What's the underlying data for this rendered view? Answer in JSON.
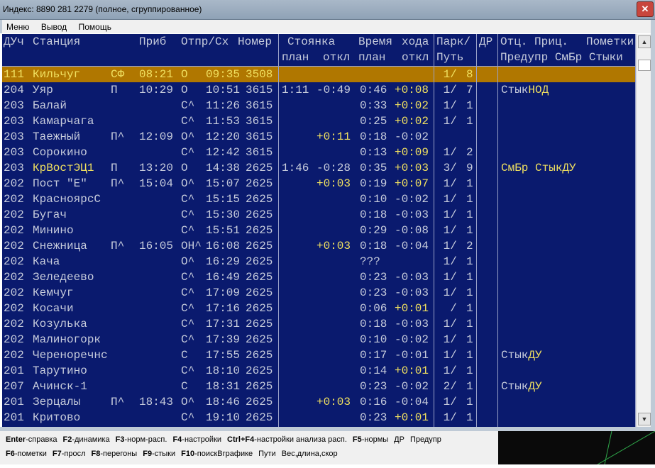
{
  "window": {
    "title": "Индекс: 8890 281 2279 (полное, сгруппированное)",
    "close_icon": "close-icon"
  },
  "menu": [
    "Меню",
    "Вывод",
    "Помощь"
  ],
  "headers": {
    "duch": "ДУч",
    "station": "Станция",
    "prib": "Приб",
    "otpr": "Отпр/Сх",
    "nomer": "Номер",
    "stoyanka": "Стоянка",
    "stoyanka_plan": "план",
    "stoyanka_otkl": "откл",
    "vremya": "Время",
    "hoda": "хода",
    "vremya_plan": "план",
    "vremya_otkl": "откл",
    "park": "Парк/",
    "put": "Путь",
    "dr": "ДР",
    "otc_pric": "Отц. Приц.",
    "pometki": "Пометки",
    "predupr": "Предупр СмБр Стыки"
  },
  "rows": [
    {
      "duch": "111",
      "station": "Кильчуг",
      "mark": "СФ",
      "prib": "08:21",
      "otpr_flag": "О",
      "otpr": "09:35",
      "nomer": "3508",
      "st_plan": "",
      "st_otkl": "",
      "vr_plan": "",
      "vr_otkl": "",
      "park": "1/",
      "put": "8",
      "pom_a": "",
      "pom_b": "",
      "selected": true
    },
    {
      "duch": "204",
      "station": "Уяр",
      "mark": "П",
      "prib": "10:29",
      "otpr_flag": "О",
      "otpr": "10:51",
      "nomer": "3615",
      "st_plan": "1:11",
      "st_otkl": "-0:49",
      "vr_plan": "0:46",
      "vr_otkl": "+0:08",
      "park": "1/",
      "put": "7",
      "pom_a": "Стык",
      "pom_b": "НОД"
    },
    {
      "duch": "203",
      "station": "Балай",
      "mark": "",
      "prib": "",
      "otpr_flag": "С^",
      "otpr": "11:26",
      "nomer": "3615",
      "st_plan": "",
      "st_otkl": "",
      "vr_plan": "0:33",
      "vr_otkl": "+0:02",
      "park": "1/",
      "put": "1",
      "pom_a": "",
      "pom_b": ""
    },
    {
      "duch": "203",
      "station": "Камарчага",
      "mark": "",
      "prib": "",
      "otpr_flag": "С^",
      "otpr": "11:53",
      "nomer": "3615",
      "st_plan": "",
      "st_otkl": "",
      "vr_plan": "0:25",
      "vr_otkl": "+0:02",
      "park": "1/",
      "put": "1",
      "pom_a": "",
      "pom_b": ""
    },
    {
      "duch": "203",
      "station": "Таежный",
      "mark": "П^",
      "prib": "12:09",
      "otpr_flag": "О^",
      "otpr": "12:20",
      "nomer": "3615",
      "st_plan": "",
      "st_otkl": "+0:11",
      "vr_plan": "0:18",
      "vr_otkl": "-0:02",
      "park": "",
      "put": "",
      "pom_a": "",
      "pom_b": ""
    },
    {
      "duch": "203",
      "station": "Сорокино",
      "mark": "",
      "prib": "",
      "otpr_flag": "С^",
      "otpr": "12:42",
      "nomer": "3615",
      "st_plan": "",
      "st_otkl": "",
      "vr_plan": "0:13",
      "vr_otkl": "+0:09",
      "park": "1/",
      "put": "2",
      "pom_a": "",
      "pom_b": ""
    },
    {
      "duch": "203",
      "station": "КрВостЭЦ1",
      "mark": "П",
      "prib": "13:20",
      "otpr_flag": "О",
      "otpr": "14:38",
      "nomer": "2625",
      "st_plan": "1:46",
      "st_otkl": "-0:28",
      "vr_plan": "0:35",
      "vr_otkl": "+0:03",
      "park": "3/",
      "put": "9",
      "pom_a": "СмБр Стык",
      "pom_b": "ДУ",
      "yellow_station": true
    },
    {
      "duch": "202",
      "station": "Пост \"Е\"",
      "mark": "П^",
      "prib": "15:04",
      "otpr_flag": "О^",
      "otpr": "15:07",
      "nomer": "2625",
      "st_plan": "",
      "st_otkl": "+0:03",
      "vr_plan": "0:19",
      "vr_otkl": "+0:07",
      "park": "1/",
      "put": "1",
      "pom_a": "",
      "pom_b": ""
    },
    {
      "duch": "202",
      "station": "КрасноярсС",
      "mark": "",
      "prib": "",
      "otpr_flag": "С^",
      "otpr": "15:15",
      "nomer": "2625",
      "st_plan": "",
      "st_otkl": "",
      "vr_plan": "0:10",
      "vr_otkl": "-0:02",
      "park": "1/",
      "put": "1",
      "pom_a": "",
      "pom_b": ""
    },
    {
      "duch": "202",
      "station": "Бугач",
      "mark": "",
      "prib": "",
      "otpr_flag": "С^",
      "otpr": "15:30",
      "nomer": "2625",
      "st_plan": "",
      "st_otkl": "",
      "vr_plan": "0:18",
      "vr_otkl": "-0:03",
      "park": "1/",
      "put": "1",
      "pom_a": "",
      "pom_b": ""
    },
    {
      "duch": "202",
      "station": "Минино",
      "mark": "",
      "prib": "",
      "otpr_flag": "С^",
      "otpr": "15:51",
      "nomer": "2625",
      "st_plan": "",
      "st_otkl": "",
      "vr_plan": "0:29",
      "vr_otkl": "-0:08",
      "park": "1/",
      "put": "1",
      "pom_a": "",
      "pom_b": ""
    },
    {
      "duch": "202",
      "station": "Снежница",
      "mark": "П^",
      "prib": "16:05",
      "otpr_flag": "ОН^",
      "otpr": "16:08",
      "nomer": "2625",
      "st_plan": "",
      "st_otkl": "+0:03",
      "vr_plan": "0:18",
      "vr_otkl": "-0:04",
      "park": "1/",
      "put": "2",
      "pom_a": "",
      "pom_b": ""
    },
    {
      "duch": "202",
      "station": "Кача",
      "mark": "",
      "prib": "",
      "otpr_flag": "О^",
      "otpr": "16:29",
      "nomer": "2625",
      "st_plan": "",
      "st_otkl": "",
      "vr_plan": "???",
      "vr_otkl": "",
      "park": "1/",
      "put": "1",
      "pom_a": "",
      "pom_b": ""
    },
    {
      "duch": "202",
      "station": "Зеледеево",
      "mark": "",
      "prib": "",
      "otpr_flag": "С^",
      "otpr": "16:49",
      "nomer": "2625",
      "st_plan": "",
      "st_otkl": "",
      "vr_plan": "0:23",
      "vr_otkl": "-0:03",
      "park": "1/",
      "put": "1",
      "pom_a": "",
      "pom_b": ""
    },
    {
      "duch": "202",
      "station": "Кемчуг",
      "mark": "",
      "prib": "",
      "otpr_flag": "С^",
      "otpr": "17:09",
      "nomer": "2625",
      "st_plan": "",
      "st_otkl": "",
      "vr_plan": "0:23",
      "vr_otkl": "-0:03",
      "park": "1/",
      "put": "1",
      "pom_a": "",
      "pom_b": ""
    },
    {
      "duch": "202",
      "station": "Косачи",
      "mark": "",
      "prib": "",
      "otpr_flag": "С^",
      "otpr": "17:16",
      "nomer": "2625",
      "st_plan": "",
      "st_otkl": "",
      "vr_plan": "0:06",
      "vr_otkl": "+0:01",
      "park": "/",
      "put": "1",
      "pom_a": "",
      "pom_b": ""
    },
    {
      "duch": "202",
      "station": "Козулька",
      "mark": "",
      "prib": "",
      "otpr_flag": "С^",
      "otpr": "17:31",
      "nomer": "2625",
      "st_plan": "",
      "st_otkl": "",
      "vr_plan": "0:18",
      "vr_otkl": "-0:03",
      "park": "1/",
      "put": "1",
      "pom_a": "",
      "pom_b": ""
    },
    {
      "duch": "202",
      "station": "Малиногорк",
      "mark": "",
      "prib": "",
      "otpr_flag": "С^",
      "otpr": "17:39",
      "nomer": "2625",
      "st_plan": "",
      "st_otkl": "",
      "vr_plan": "0:10",
      "vr_otkl": "-0:02",
      "park": "1/",
      "put": "1",
      "pom_a": "",
      "pom_b": ""
    },
    {
      "duch": "202",
      "station": "Череноречнс",
      "mark": "",
      "prib": "",
      "otpr_flag": "С",
      "otpr": "17:55",
      "nomer": "2625",
      "st_plan": "",
      "st_otkl": "",
      "vr_plan": "0:17",
      "vr_otkl": "-0:01",
      "park": "1/",
      "put": "1",
      "pom_a": "Стык",
      "pom_b": "ДУ"
    },
    {
      "duch": "201",
      "station": "Тарутино",
      "mark": "",
      "prib": "",
      "otpr_flag": "С^",
      "otpr": "18:10",
      "nomer": "2625",
      "st_plan": "",
      "st_otkl": "",
      "vr_plan": "0:14",
      "vr_otkl": "+0:01",
      "park": "1/",
      "put": "1",
      "pom_a": "",
      "pom_b": ""
    },
    {
      "duch": "207",
      "station": "Ачинск-1",
      "mark": "",
      "prib": "",
      "otpr_flag": "С",
      "otpr": "18:31",
      "nomer": "2625",
      "st_plan": "",
      "st_otkl": "",
      "vr_plan": "0:23",
      "vr_otkl": "-0:02",
      "park": "2/",
      "put": "1",
      "pom_a": "Стык",
      "pom_b": "ДУ"
    },
    {
      "duch": "201",
      "station": "Зерцалы",
      "mark": "П^",
      "prib": "18:43",
      "otpr_flag": "О^",
      "otpr": "18:46",
      "nomer": "2625",
      "st_plan": "",
      "st_otkl": "+0:03",
      "vr_plan": "0:16",
      "vr_otkl": "-0:04",
      "park": "1/",
      "put": "1",
      "pom_a": "",
      "pom_b": ""
    },
    {
      "duch": "201",
      "station": "Критово",
      "mark": "",
      "prib": "",
      "otpr_flag": "С^",
      "otpr": "19:10",
      "nomer": "2625",
      "st_plan": "",
      "st_otkl": "",
      "vr_plan": "0:23",
      "vr_otkl": "+0:01",
      "park": "1/",
      "put": "1",
      "pom_a": "",
      "pom_b": ""
    }
  ],
  "fkeys_line1": [
    {
      "key": "Enter",
      "label": "-справка"
    },
    {
      "key": "F2",
      "label": "-динамика"
    },
    {
      "key": "F3",
      "label": "-норм-расп."
    },
    {
      "key": "F4",
      "label": "-настройки"
    },
    {
      "key": "Ctrl+F4",
      "label": "-настройки анализа расп."
    },
    {
      "key": "F5",
      "label": "-нормы"
    },
    {
      "key": "",
      "label": "ДР"
    },
    {
      "key": "",
      "label": "Предупр"
    }
  ],
  "fkeys_line2": [
    {
      "key": "F6",
      "label": "-пометки"
    },
    {
      "key": "F7",
      "label": "-просл"
    },
    {
      "key": "F8",
      "label": "-перегоны"
    },
    {
      "key": "F9",
      "label": "-стыки"
    },
    {
      "key": "F10",
      "label": "-поискВграфике"
    },
    {
      "key": "",
      "label": "Пути"
    },
    {
      "key": "",
      "label": "Вес,длина,скор"
    }
  ],
  "colors": {
    "bg": "#0a1a6e",
    "text": "#c7ccdc",
    "yellow": "#f0e060",
    "selected": "#b07700"
  }
}
